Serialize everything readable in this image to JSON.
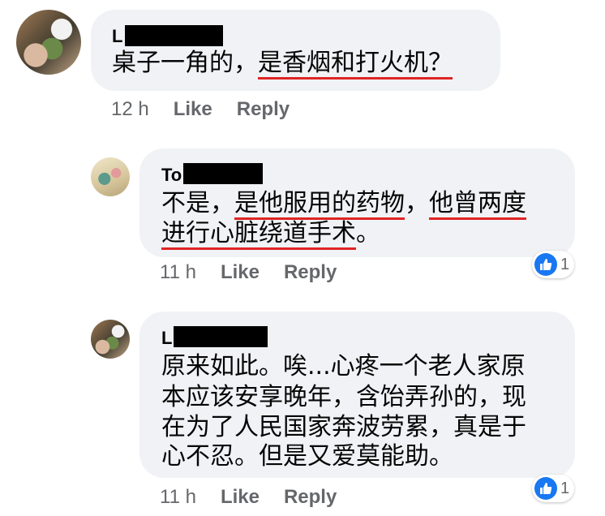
{
  "comments": [
    {
      "name": "L",
      "text_parts": [
        "桌子一角的，",
        "是香烟和打火机？"
      ],
      "time": "12 h",
      "like_label": "Like",
      "reply_label": "Reply"
    },
    {
      "name": "To",
      "line1": [
        "不是，",
        "是他服用的药物",
        "，",
        "他曾两度"
      ],
      "line2": [
        "进行心脏绕道手术",
        "。"
      ],
      "time": "11 h",
      "like_label": "Like",
      "reply_label": "Reply",
      "reaction_count": "1"
    },
    {
      "name": "L",
      "lines": [
        "原来如此。唉...心疼一个老人家原",
        "本应该安享晚年，含饴弄孙的，现",
        "在为了人民国家奔波劳累，真是于",
        "心不忍。但是又爱莫能助。"
      ],
      "time": "11 h",
      "like_label": "Like",
      "reply_label": "Reply",
      "reaction_count": "1"
    }
  ],
  "icons": {
    "reaction": "thumbs-up-icon",
    "reaction_color": "#1877f2"
  },
  "colors": {
    "bubble": "#f0f2f5",
    "underline": "#e02424",
    "meta": "#65676b"
  }
}
